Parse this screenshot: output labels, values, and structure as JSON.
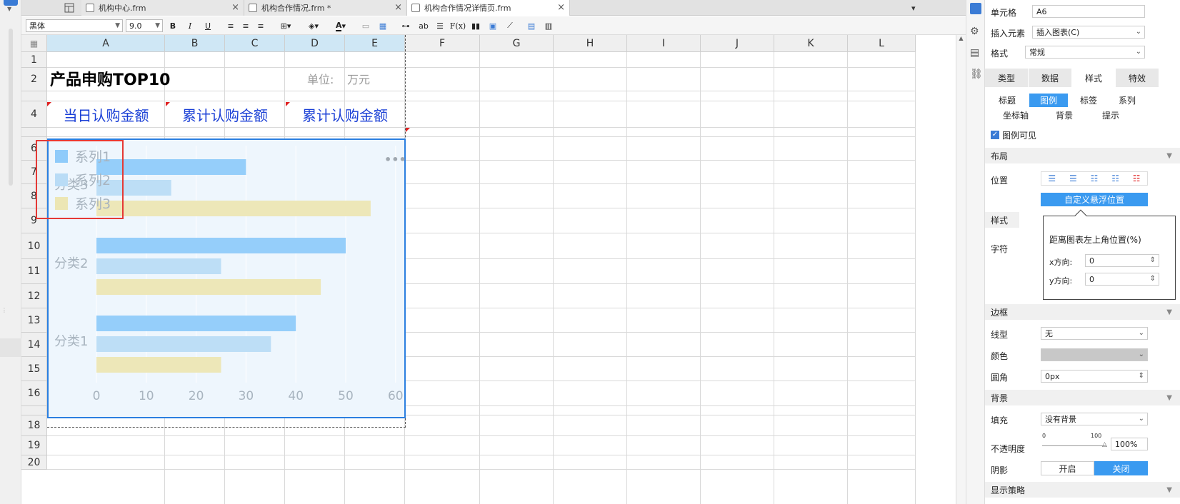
{
  "tabs": [
    {
      "label": "机构中心.frm",
      "active": false
    },
    {
      "label": "机构合作情况.frm *",
      "active": false
    },
    {
      "label": "机构合作情况详情页.frm",
      "active": true
    }
  ],
  "toolbar": {
    "font": "黑体",
    "size": "9.0",
    "bold": "B",
    "italic": "I",
    "underline": "U",
    "text_color_icon": "A",
    "ab_icon": "ab",
    "formula_icon": "F(x)"
  },
  "columns": [
    "A",
    "B",
    "C",
    "D",
    "E",
    "F",
    "G",
    "H",
    "I",
    "J",
    "K",
    "L"
  ],
  "rows": [
    "1",
    "2",
    "",
    "4",
    "",
    "6",
    "7",
    "8",
    "9",
    "10",
    "11",
    "12",
    "13",
    "14",
    "15",
    "16",
    "",
    "18",
    "19",
    "20"
  ],
  "cells": {
    "title": "产品申购TOP10",
    "unit_label": "单位:",
    "unit_value": "万元",
    "h1": "当日认购金额",
    "h2": "累计认购金额",
    "h3": "累计认购金额"
  },
  "chart_data": {
    "type": "bar",
    "orientation": "horizontal",
    "categories": [
      "分类3",
      "分类2",
      "分类1"
    ],
    "series": [
      {
        "name": "系列1",
        "color": "#8fcbfa",
        "values": [
          30,
          50,
          40
        ]
      },
      {
        "name": "系列2",
        "color": "#b9dcf6",
        "values": [
          15,
          25,
          35
        ]
      },
      {
        "name": "系列3",
        "color": "#ece6b4",
        "values": [
          55,
          45,
          25
        ]
      }
    ],
    "xticks": [
      "0",
      "10",
      "20",
      "30",
      "40",
      "50",
      "60"
    ],
    "xlim": [
      0,
      60
    ],
    "legend": "top-left",
    "grid": true,
    "more_icon": "•••"
  },
  "panel": {
    "cell_label": "单元格",
    "cell_value": "A6",
    "insert_label": "插入元素",
    "insert_value": "插入图表(C)",
    "format_label": "格式",
    "format_value": "常规",
    "main_tabs": [
      "类型",
      "数据",
      "样式",
      "特效"
    ],
    "sub_tabs_row1": [
      "标题",
      "图例",
      "标签",
      "系列"
    ],
    "sub_tabs_row2": [
      "坐标轴",
      "背景",
      "提示"
    ],
    "legend_visible": "图例可见",
    "layout_section": "布局",
    "position_label": "位置",
    "custom_float_btn": "自定义悬浮位置",
    "style_section": "样式",
    "char_label": "字符",
    "popup_title": "距离图表左上角位置(%)",
    "x_label": "x方向:",
    "x_value": "0",
    "y_label": "y方向:",
    "y_value": "0",
    "border_section": "边框",
    "linetype_label": "线型",
    "linetype_value": "无",
    "color_label": "颜色",
    "radius_label": "圆角",
    "radius_value": "0px",
    "bg_section": "背景",
    "fill_label": "填充",
    "fill_value": "没有背景",
    "opacity_label": "不透明度",
    "opacity_min": "0",
    "opacity_max": "100",
    "opacity_value": "100%",
    "shadow_label": "阴影",
    "shadow_on": "开启",
    "shadow_off": "关闭",
    "display_section": "显示策略"
  },
  "colors": {
    "accent": "#3a9af0",
    "selection": "#2b7fe0",
    "highlight_box": "#e53935",
    "header_text": "#1a3fd6"
  }
}
